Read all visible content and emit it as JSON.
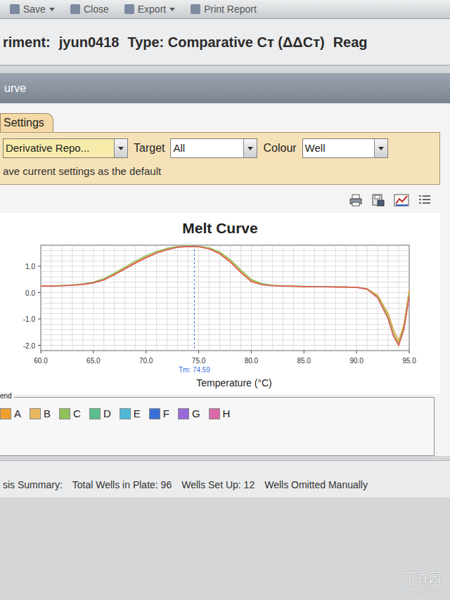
{
  "toolbar": [
    {
      "label": "Save",
      "dropdown": true
    },
    {
      "label": "Close",
      "dropdown": false
    },
    {
      "label": "Export",
      "dropdown": true
    },
    {
      "label": "Print Report",
      "dropdown": false
    }
  ],
  "header": {
    "experiment_label": "riment:",
    "experiment": "jyun0418",
    "type": "Type: Comparative Cт (ΔΔCт)",
    "reagent_label": "Reag"
  },
  "panel": {
    "title": "urve"
  },
  "settings": {
    "tab": "Settings",
    "plot_type": "Derivative Repo...",
    "target_label": "Target",
    "target": "All",
    "colour_label": "Colour",
    "colour": "Well",
    "save_default": "ave current settings as the default"
  },
  "chart": {
    "title": "Melt Curve",
    "x_label": "Temperature (°C)",
    "x_ticks": [
      "60.0",
      "65.0",
      "70.0",
      "75.0",
      "80.0",
      "85.0",
      "90.0",
      "95.0"
    ],
    "y_ticks": [
      "1.0",
      "0.0",
      "-1.0",
      "-2.0"
    ],
    "marker": {
      "label": "Tm: 74.59",
      "value": 74.59
    },
    "x_values": [
      60,
      61,
      62,
      63,
      64,
      65,
      66,
      67,
      68,
      69,
      70,
      71,
      72,
      73,
      74,
      75,
      76,
      77,
      78,
      79,
      80,
      81,
      82,
      83,
      84,
      85,
      86,
      87,
      88,
      89,
      90,
      91,
      92,
      93,
      93.5,
      94,
      94.5,
      95
    ],
    "series": [
      {
        "color": "#e8a040",
        "values": [
          0.25,
          0.25,
          0.26,
          0.28,
          0.32,
          0.38,
          0.5,
          0.7,
          0.92,
          1.15,
          1.35,
          1.52,
          1.65,
          1.73,
          1.76,
          1.75,
          1.68,
          1.5,
          1.2,
          0.8,
          0.45,
          0.32,
          0.27,
          0.25,
          0.24,
          0.23,
          0.23,
          0.22,
          0.22,
          0.21,
          0.2,
          0.15,
          -0.1,
          -0.8,
          -1.4,
          -1.85,
          -1.2,
          0.1
        ]
      },
      {
        "color": "#8fbf5a",
        "values": [
          0.26,
          0.26,
          0.27,
          0.29,
          0.33,
          0.4,
          0.53,
          0.74,
          0.97,
          1.2,
          1.4,
          1.56,
          1.68,
          1.75,
          1.77,
          1.76,
          1.7,
          1.54,
          1.25,
          0.86,
          0.5,
          0.34,
          0.28,
          0.26,
          0.25,
          0.24,
          0.23,
          0.23,
          0.22,
          0.21,
          0.2,
          0.14,
          -0.15,
          -0.9,
          -1.55,
          -1.95,
          -1.3,
          -0.05
        ]
      },
      {
        "color": "#e05a5a",
        "values": [
          0.25,
          0.25,
          0.26,
          0.28,
          0.31,
          0.37,
          0.48,
          0.68,
          0.9,
          1.12,
          1.32,
          1.5,
          1.63,
          1.72,
          1.75,
          1.74,
          1.66,
          1.47,
          1.16,
          0.76,
          0.42,
          0.3,
          0.26,
          0.25,
          0.24,
          0.23,
          0.22,
          0.22,
          0.21,
          0.21,
          0.2,
          0.13,
          -0.2,
          -1.0,
          -1.65,
          -2.0,
          -1.4,
          -0.15
        ]
      }
    ]
  },
  "legend": {
    "label": "end",
    "items": [
      {
        "label": "A",
        "color": "#f0a030"
      },
      {
        "label": "B",
        "color": "#e8b860"
      },
      {
        "label": "C",
        "color": "#8fc25a"
      },
      {
        "label": "D",
        "color": "#5cc08c"
      },
      {
        "label": "E",
        "color": "#4fb8d8"
      },
      {
        "label": "F",
        "color": "#3a6fd8"
      },
      {
        "label": "G",
        "color": "#9a6ad8"
      },
      {
        "label": "H",
        "color": "#d86aa8"
      }
    ]
  },
  "summary": {
    "label": "sis Summary:",
    "items": [
      "Total Wells in Plate: 96",
      "Wells Set Up: 12",
      "Wells Omitted Manually"
    ]
  },
  "watermark": {
    "text": "丁香园",
    "url": "www.dxy.cn"
  }
}
